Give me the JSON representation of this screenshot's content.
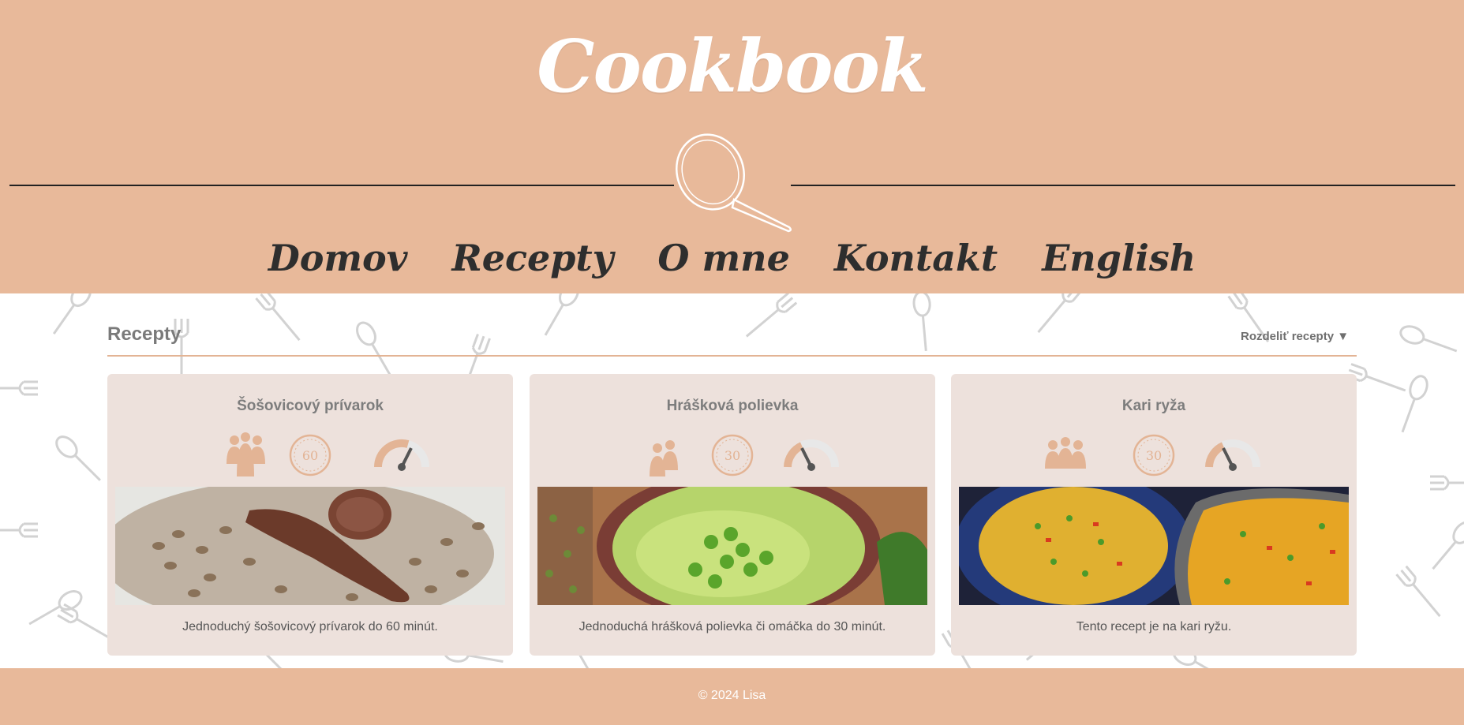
{
  "header": {
    "logo": "Cookbook",
    "nav": [
      "Domov",
      "Recepty",
      "O mne",
      "Kontakt",
      "English"
    ]
  },
  "section": {
    "title": "Recepty",
    "split_label": "Rozdeliť recepty ▼"
  },
  "cards": [
    {
      "title": "Šošovicový prívarok",
      "time": "60",
      "servings_icon": "people-icon",
      "difficulty": 0.65,
      "description": "Jednoduchý šošovicový prívarok do 60 minút."
    },
    {
      "title": "Hrášková polievka",
      "time": "30",
      "servings_icon": "people-icon",
      "difficulty": 0.3,
      "description": "Jednoduchá hrášková polievka či omáčka do 30 minút."
    },
    {
      "title": "Kari ryža",
      "time": "30",
      "servings_icon": "people-icon",
      "difficulty": 0.3,
      "description": "Tento recept je na kari ryžu."
    }
  ],
  "footer": {
    "copyright": "© 2024 Lisa"
  },
  "colors": {
    "brand": "#e8b99a",
    "card": "#ede1dc",
    "accent": "#e3b495",
    "text_dark": "#2e2e2e"
  }
}
